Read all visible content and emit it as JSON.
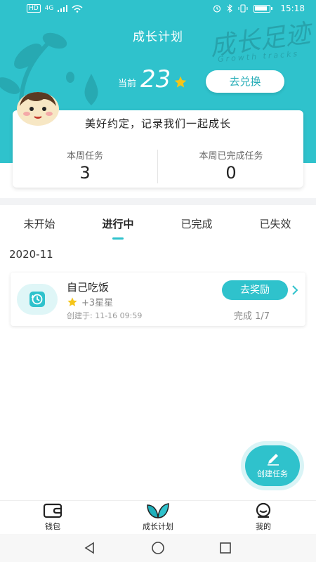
{
  "status_bar": {
    "left_chips": [
      "HD",
      "4G"
    ],
    "time": "15:18"
  },
  "header": {
    "title": "成长计划",
    "brand_text": "成长足迹",
    "brand_subtext": "Growth tracks"
  },
  "points": {
    "prefix": "当前",
    "value": "23",
    "redeem_label": "去兑换"
  },
  "summary": {
    "slogan": "美好约定，记录我们一起成长",
    "weekly_tasks_label": "本周任务",
    "weekly_tasks_value": "3",
    "weekly_done_label": "本周已完成任务",
    "weekly_done_value": "0"
  },
  "tabs": [
    {
      "label": "未开始",
      "active": false
    },
    {
      "label": "进行中",
      "active": true
    },
    {
      "label": "已完成",
      "active": false
    },
    {
      "label": "已失效",
      "active": false
    }
  ],
  "month": "2020-11",
  "tasks": [
    {
      "title": "自己吃饭",
      "reward": "+3星星",
      "created": "创建于:  11-16 09:59",
      "action": "去奖励",
      "progress": "完成 1/7"
    }
  ],
  "fab": {
    "label": "创建任务"
  },
  "bottom_nav": [
    {
      "label": "钱包",
      "icon": "wallet-icon"
    },
    {
      "label": "成长计划",
      "icon": "growth-leaf-icon"
    },
    {
      "label": "我的",
      "icon": "profile-icon"
    }
  ],
  "colors": {
    "accent": "#2fc2cc",
    "star": "#f5c518"
  }
}
